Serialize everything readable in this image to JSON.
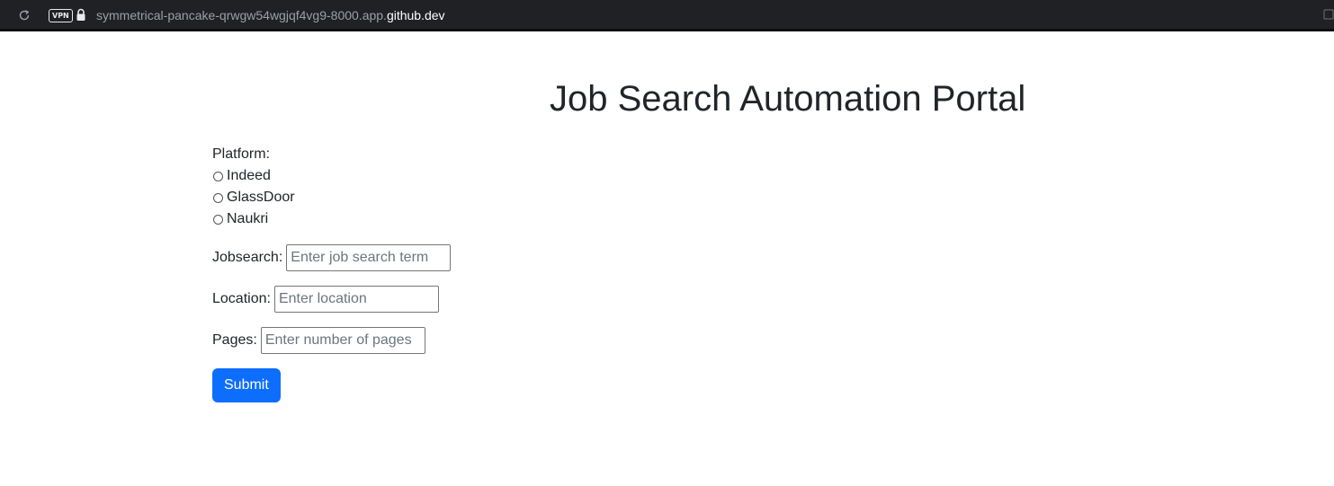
{
  "browser": {
    "vpn_label": "VPN",
    "url_subdomain": "symmetrical-pancake-qrwgw54wgjqf4vg9-8000.app.",
    "url_domain": "github.dev"
  },
  "page": {
    "title": "Job Search Automation Portal"
  },
  "form": {
    "platform_label": "Platform:",
    "platform_options": [
      "Indeed",
      "GlassDoor",
      "Naukri"
    ],
    "jobsearch_label": "Jobsearch:",
    "jobsearch_placeholder": "Enter job search term",
    "location_label": "Location:",
    "location_placeholder": "Enter location",
    "pages_label": "Pages:",
    "pages_placeholder": "Enter number of pages",
    "submit_label": "Submit"
  },
  "colors": {
    "browser_bar": "#202124",
    "submit_button": "#0d6efd",
    "text": "#212529"
  },
  "icons": [
    "reload-icon",
    "lock-icon",
    "extension-icon"
  ]
}
